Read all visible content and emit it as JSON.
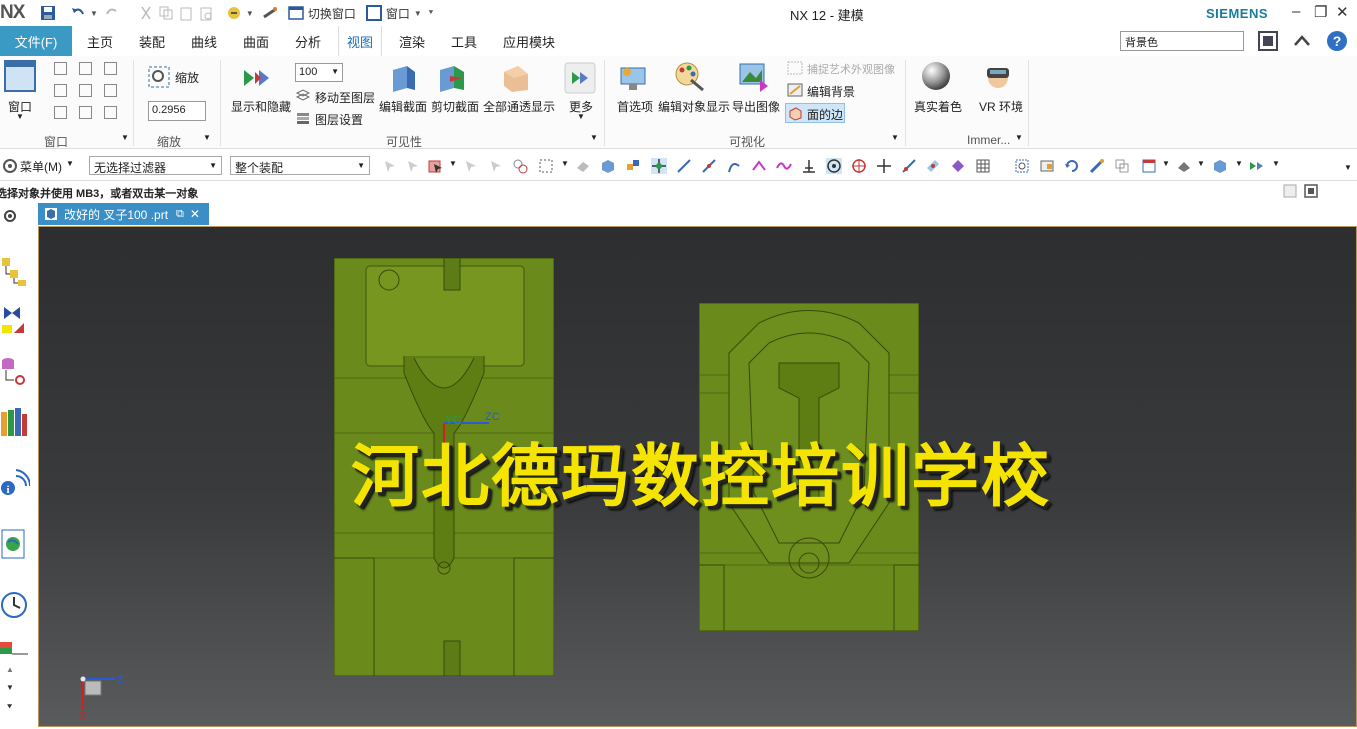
{
  "titlebar": {
    "logo": "NX",
    "switch_window": "切换窗口",
    "window_menu": "窗口",
    "title": "NX 12 - 建模",
    "brand": "SIEMENS"
  },
  "menu": {
    "file": "文件(F)",
    "tabs": [
      "主页",
      "装配",
      "曲线",
      "曲面",
      "分析",
      "视图",
      "渲染",
      "工具",
      "应用模块"
    ],
    "active_tab": "视图",
    "search_value": "背景色"
  },
  "ribbon": {
    "window_btn": "窗口",
    "zoom_btn": "缩放",
    "zoom_value": "0.2956",
    "scale_value": "100",
    "show_hide": "显示和隐藏",
    "move_to_layer": "移动至图层",
    "layer_settings": "图层设置",
    "edit_section": "编辑截面",
    "clip_section": "剪切截面",
    "all_transparent": "全部通透显示",
    "more": "更多",
    "preferences": "首选项",
    "edit_object_display": "编辑对象显示",
    "export_image": "导出图像",
    "capture_art": "捕捉艺术外观图像",
    "edit_background": "编辑背景",
    "face_edges": "面的边",
    "true_shading": "真实着色",
    "vr_env": "VR 环境",
    "groups": {
      "window": "窗口",
      "zoom": "缩放",
      "visibility": "可见性",
      "visualization": "可视化",
      "immersive": "Immer..."
    }
  },
  "toolbar": {
    "menu": "菜单(M)",
    "filter": "无选择过滤器",
    "assembly": "整个装配"
  },
  "cue": "选择对象并使用 MB3，或者双击某一对象",
  "document_tab": "改好的 叉子100 .prt",
  "viewport": {
    "watermark": "河北德玛数控培训学校",
    "csys_label_yc": "YC",
    "csys_label_zc": "ZC",
    "triad_z": "Z",
    "triad_x": "X"
  },
  "colors": {
    "accent": "#3a9ac4",
    "model_green": "#6a8a1c",
    "watermark": "#f4e400"
  }
}
